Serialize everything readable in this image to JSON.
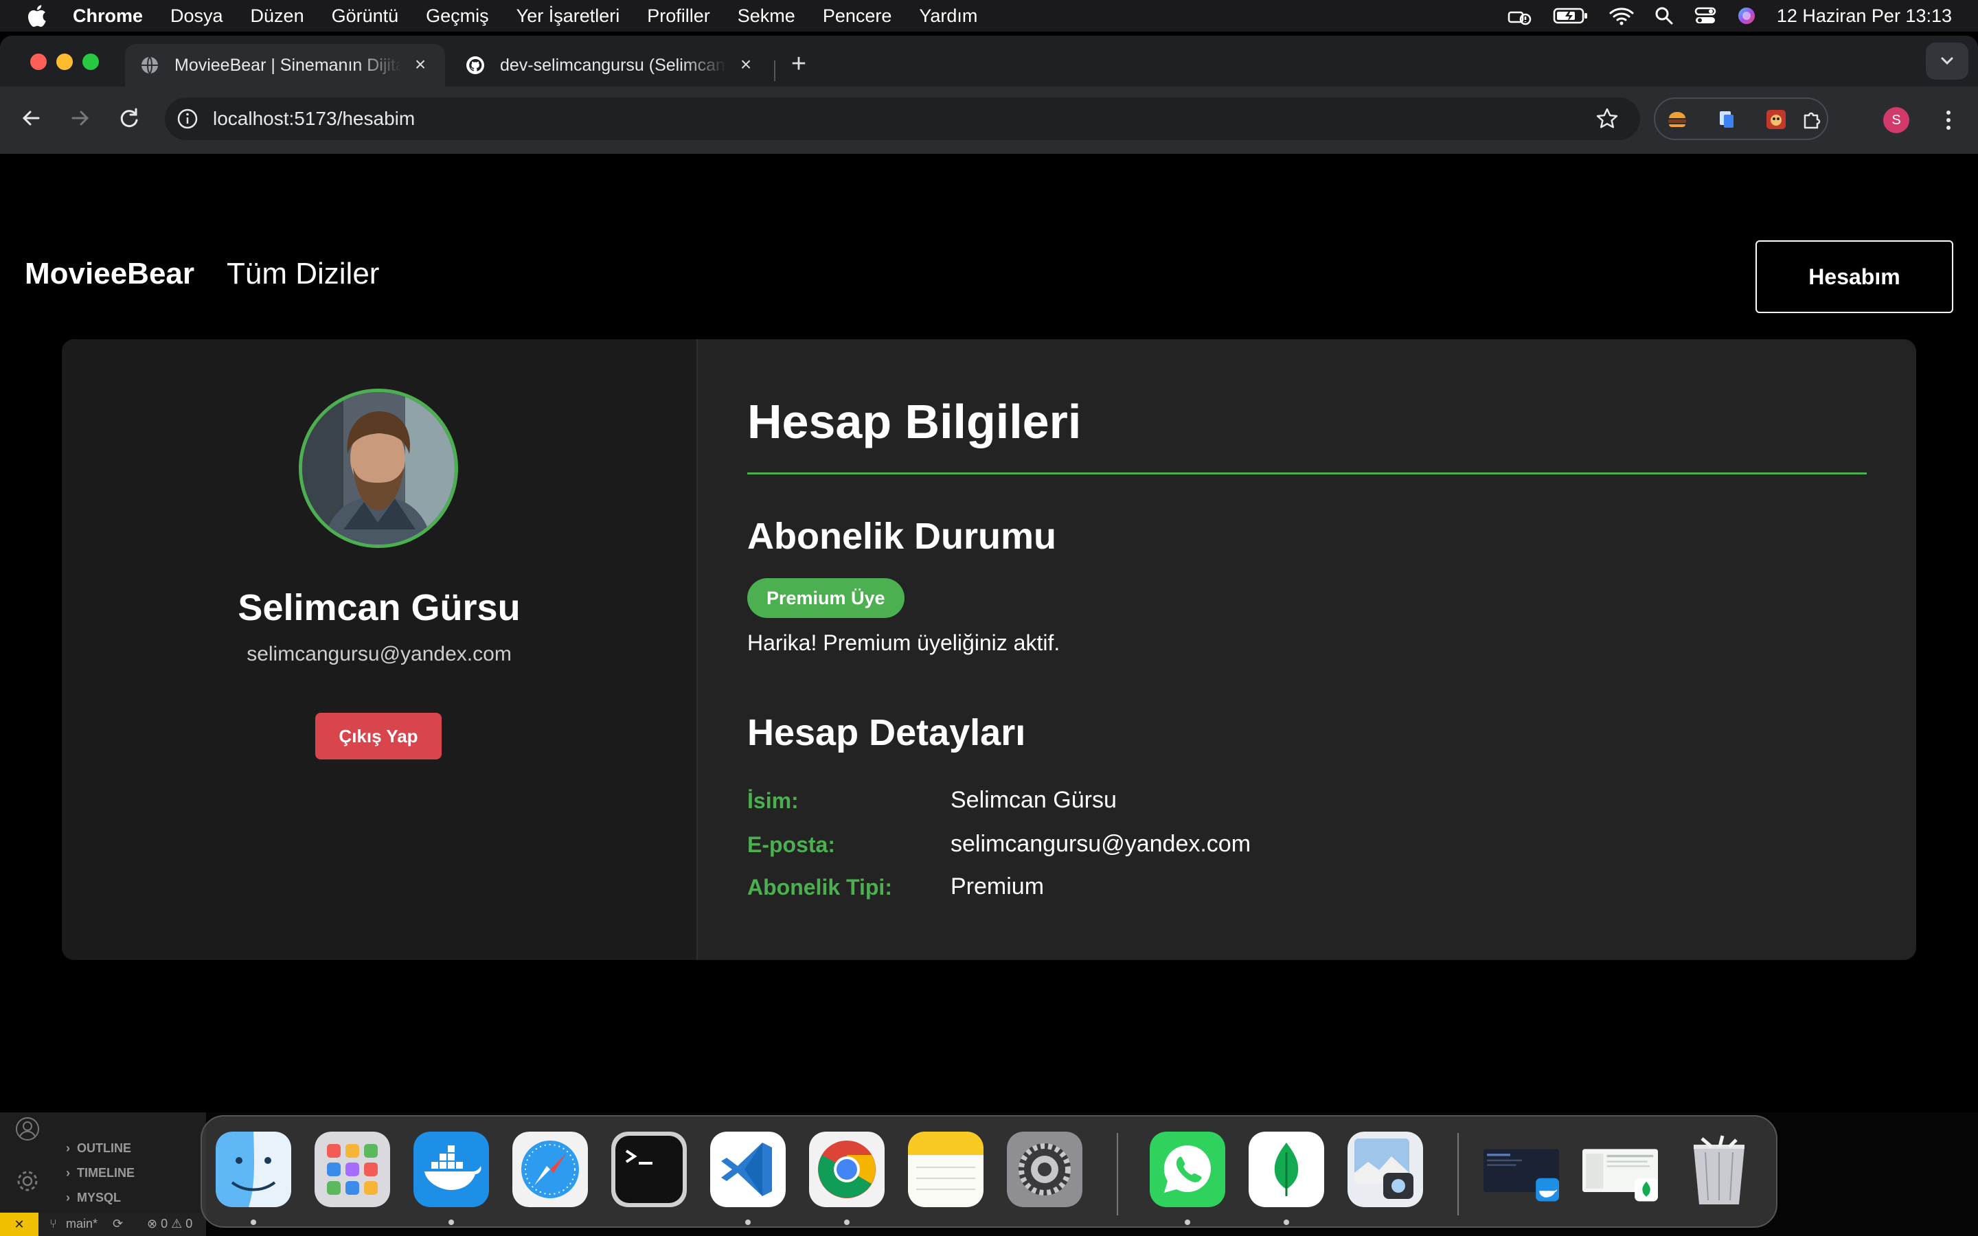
{
  "menubar": {
    "items": [
      "Chrome",
      "Dosya",
      "Düzen",
      "Görüntü",
      "Geçmiş",
      "Yer İşaretleri",
      "Profiller",
      "Sekme",
      "Pencere",
      "Yardım"
    ],
    "clock": "12 Haziran Per  13:13"
  },
  "browser": {
    "tabs": [
      {
        "title": "MovieeBear | Sinemanın Dijital Dünyası",
        "active": true
      },
      {
        "title": "dev-selimcangursu (Selimcan Gürsu)",
        "active": false
      }
    ],
    "url": "localhost:5173/hesabim",
    "profile_initial": "S"
  },
  "site": {
    "brand": "MovieeBear",
    "nav_series": "Tüm Diziler",
    "account_button": "Hesabım"
  },
  "profile": {
    "name": "Selimcan Gürsu",
    "email": "selimcangursu@yandex.com",
    "logout": "Çıkış Yap"
  },
  "account": {
    "heading": "Hesap Bilgileri",
    "subscription_heading": "Abonelik Durumu",
    "badge": "Premium Üye",
    "subscription_message": "Harika! Premium üyeliğiniz aktif.",
    "details_heading": "Hesap Detayları",
    "details": [
      {
        "label": "İsim:",
        "value": "Selimcan Gürsu"
      },
      {
        "label": "E-posta:",
        "value": "selimcangursu@yandex.com"
      },
      {
        "label": "Abonelik Tipi:",
        "value": "Premium"
      }
    ]
  },
  "vscode": {
    "sections": [
      "OUTLINE",
      "TIMELINE",
      "MYSQL"
    ],
    "branch": "main*",
    "problems": "⊗ 0 ⚠ 0"
  },
  "colors": {
    "accent": "#4caf50",
    "danger": "#d9454c",
    "card": "#232323",
    "card_left": "#1b1b1b"
  }
}
